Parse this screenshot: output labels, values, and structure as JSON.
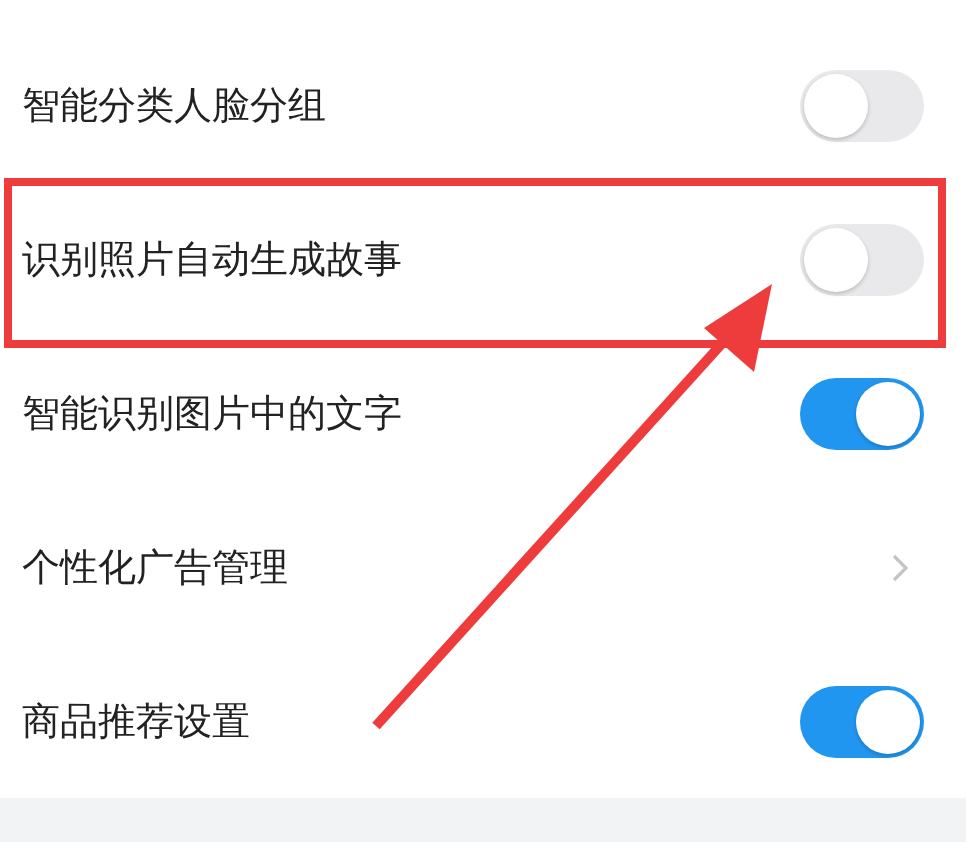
{
  "settings": [
    {
      "kind": "toggle",
      "label": "智能分类人脸分组",
      "on": false,
      "highlighted": false
    },
    {
      "kind": "toggle",
      "label": "识别照片自动生成故事",
      "on": false,
      "highlighted": true
    },
    {
      "kind": "toggle",
      "label": "智能识别图片中的文字",
      "on": true,
      "highlighted": false
    },
    {
      "kind": "link",
      "label": "个性化广告管理",
      "highlighted": false
    },
    {
      "kind": "toggle",
      "label": "商品推荐设置",
      "on": true,
      "highlighted": false
    }
  ]
}
